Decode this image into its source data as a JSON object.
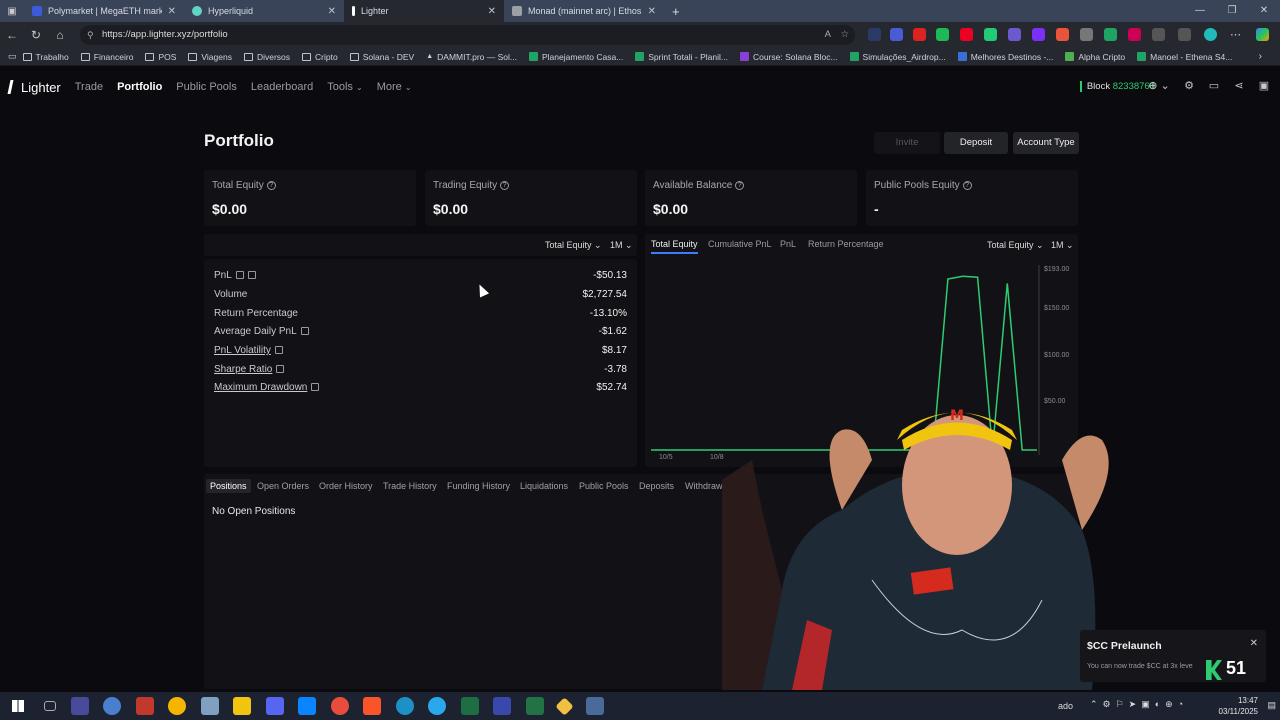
{
  "browser": {
    "tabs": [
      {
        "title": "Polymarket | MegaETH market ca",
        "color": "#3b5bdb"
      },
      {
        "title": "Hyperliquid",
        "color": "#5fd3c7"
      },
      {
        "title": "Lighter",
        "color": "#ffffff"
      },
      {
        "title": "Monad (mainnet arc) | Ethos cred",
        "color": "#9aa0a6"
      }
    ],
    "url": "https://app.lighter.xyz/portfolio",
    "bookmarks": [
      "Trabalho",
      "Financeiro",
      "POS",
      "Viagens",
      "Diversos",
      "Cripto",
      "Solana - DEV",
      "DAMMIT.pro — Sol...",
      "Planejamento Casa...",
      "Sprint Totali - Planil...",
      "Course: Solana Bloc...",
      "Simulações_Airdrop...",
      "Melhores Destinos -...",
      "Alpha Cripto",
      "Manoel - Ethena S4..."
    ]
  },
  "app": {
    "logo": "Lighter",
    "nav": [
      "Trade",
      "Portfolio",
      "Public Pools",
      "Leaderboard",
      "Tools",
      "More"
    ],
    "block_label": "Block",
    "block_number": "82338760"
  },
  "page": {
    "title": "Portfolio",
    "buttons": {
      "invite": "Invite",
      "deposit": "Deposit",
      "account_type": "Account Type"
    },
    "cards": [
      {
        "label": "Total Equity",
        "value": "$0.00"
      },
      {
        "label": "Trading Equity",
        "value": "$0.00"
      },
      {
        "label": "Available Balance",
        "value": "$0.00"
      },
      {
        "label": "Public Pools Equity",
        "value": "-"
      }
    ],
    "stats_controls": {
      "metric": "Total Equity",
      "range": "1M"
    },
    "stats": [
      {
        "label": "PnL",
        "value": "-$50.13"
      },
      {
        "label": "Volume",
        "value": "$2,727.54"
      },
      {
        "label": "Return Percentage",
        "value": "-13.10%"
      },
      {
        "label": "Average Daily PnL",
        "value": "-$1.62"
      },
      {
        "label": "PnL Volatility",
        "value": "$8.17"
      },
      {
        "label": "Sharpe Ratio",
        "value": "-3.78"
      },
      {
        "label": "Maximum Drawdown",
        "value": "$52.74"
      }
    ],
    "chart_tabs": [
      "Total Equity",
      "Cumulative PnL",
      "PnL",
      "Return Percentage"
    ],
    "chart_controls": {
      "metric": "Total Equity",
      "range": "1M"
    },
    "bottom_tabs": [
      "Positions",
      "Open Orders",
      "Order History",
      "Trade History",
      "Funding History",
      "Liquidations",
      "Public Pools",
      "Deposits",
      "Withdrawals"
    ],
    "empty_state": "No Open Positions"
  },
  "chart_data": {
    "type": "line",
    "yticks": [
      "$193.00",
      "$150.00",
      "$100.00",
      "$50.00"
    ],
    "xticks": [
      "10/5",
      "10/8"
    ],
    "series": [
      {
        "color": "#2ecc71",
        "values": [
          0,
          0,
          0,
          0,
          0,
          0,
          0,
          0,
          0,
          0,
          0,
          0,
          0,
          0,
          0,
          0,
          0,
          0,
          0,
          0,
          190,
          193,
          192,
          0,
          185,
          0,
          0
        ]
      }
    ],
    "ylim": [
      0,
      200
    ]
  },
  "toast": {
    "title": "$CC Prelaunch",
    "body": "You can now trade $CC at 3x leve",
    "badge": "51"
  },
  "taskbar": {
    "time": "13:47",
    "date": "03/11/2025",
    "tray_text": "ado"
  }
}
